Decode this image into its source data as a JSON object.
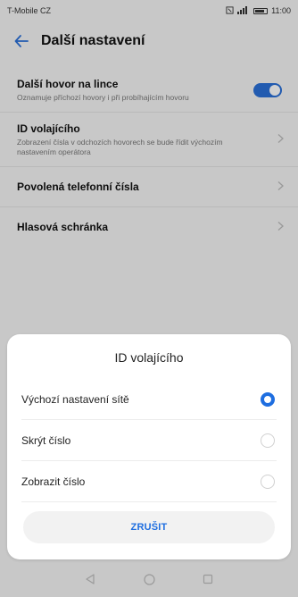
{
  "status_bar": {
    "carrier": "T-Mobile CZ",
    "time": "11:00"
  },
  "header": {
    "title": "Další nastavení"
  },
  "settings": [
    {
      "title": "Další hovor na lince",
      "subtitle": "Oznamuje příchozí hovory i při probíhajícím hovoru",
      "control": "toggle",
      "on": true
    },
    {
      "title": "ID volajícího",
      "subtitle": "Zobrazení čísla v odchozích hovorech se bude řídit výchozím nastavením operátora",
      "control": "chevron"
    },
    {
      "title": "Povolená telefonní čísla",
      "control": "chevron"
    },
    {
      "title": "Hlasová schránka",
      "control": "chevron"
    }
  ],
  "dialog": {
    "title": "ID volajícího",
    "options": [
      {
        "label": "Výchozí nastavení sítě",
        "selected": true
      },
      {
        "label": "Skrýt číslo",
        "selected": false
      },
      {
        "label": "Zobrazit číslo",
        "selected": false
      }
    ],
    "cancel_label": "ZRUŠIT"
  },
  "colors": {
    "accent": "#1e6ee0",
    "toggle_on": "#2a6fd7"
  },
  "icons": {
    "back": "arrow-left-icon",
    "chevron": "chevron-right-icon",
    "nav_back": "triangle-back-icon",
    "nav_home": "circle-home-icon",
    "nav_recent": "square-recent-icon"
  }
}
